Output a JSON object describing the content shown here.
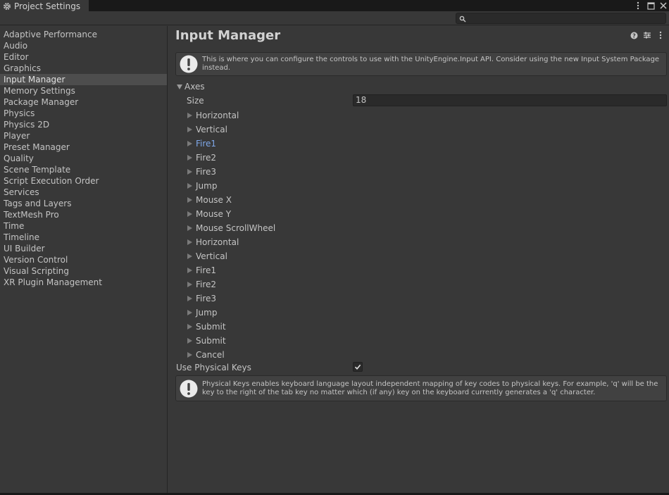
{
  "window": {
    "tab_title": "Project Settings"
  },
  "search": {
    "placeholder": "",
    "value": ""
  },
  "sidebar": {
    "items": [
      {
        "label": "Adaptive Performance",
        "selected": false
      },
      {
        "label": "Audio",
        "selected": false
      },
      {
        "label": "Editor",
        "selected": false
      },
      {
        "label": "Graphics",
        "selected": false
      },
      {
        "label": "Input Manager",
        "selected": true
      },
      {
        "label": "Memory Settings",
        "selected": false
      },
      {
        "label": "Package Manager",
        "selected": false
      },
      {
        "label": "Physics",
        "selected": false
      },
      {
        "label": "Physics 2D",
        "selected": false
      },
      {
        "label": "Player",
        "selected": false
      },
      {
        "label": "Preset Manager",
        "selected": false
      },
      {
        "label": "Quality",
        "selected": false
      },
      {
        "label": "Scene Template",
        "selected": false
      },
      {
        "label": "Script Execution Order",
        "selected": false
      },
      {
        "label": "Services",
        "selected": false
      },
      {
        "label": "Tags and Layers",
        "selected": false
      },
      {
        "label": "TextMesh Pro",
        "selected": false
      },
      {
        "label": "Time",
        "selected": false
      },
      {
        "label": "Timeline",
        "selected": false
      },
      {
        "label": "UI Builder",
        "selected": false
      },
      {
        "label": "Version Control",
        "selected": false
      },
      {
        "label": "Visual Scripting",
        "selected": false
      },
      {
        "label": "XR Plugin Management",
        "selected": false
      }
    ]
  },
  "main": {
    "title": "Input Manager",
    "help_top": "This is where you can configure the controls to use with the UnityEngine.Input API. Consider using the new Input System Package instead.",
    "axes_label": "Axes",
    "size_label": "Size",
    "size_value": "18",
    "axes": [
      {
        "label": "Horizontal",
        "active": false
      },
      {
        "label": "Vertical",
        "active": false
      },
      {
        "label": "Fire1",
        "active": true
      },
      {
        "label": "Fire2",
        "active": false
      },
      {
        "label": "Fire3",
        "active": false
      },
      {
        "label": "Jump",
        "active": false
      },
      {
        "label": "Mouse X",
        "active": false
      },
      {
        "label": "Mouse Y",
        "active": false
      },
      {
        "label": "Mouse ScrollWheel",
        "active": false
      },
      {
        "label": "Horizontal",
        "active": false
      },
      {
        "label": "Vertical",
        "active": false
      },
      {
        "label": "Fire1",
        "active": false
      },
      {
        "label": "Fire2",
        "active": false
      },
      {
        "label": "Fire3",
        "active": false
      },
      {
        "label": "Jump",
        "active": false
      },
      {
        "label": "Submit",
        "active": false
      },
      {
        "label": "Submit",
        "active": false
      },
      {
        "label": "Cancel",
        "active": false
      }
    ],
    "physical_keys_label": "Use Physical Keys",
    "physical_keys_checked": true,
    "help_bottom": "Physical Keys enables keyboard language layout independent mapping of key codes to physical keys. For example, 'q' will be the key to the right of the tab key no matter which (if any) key on the keyboard currently generates a 'q' character."
  },
  "colors": {
    "background": "#383838",
    "selected_item": "#4d4d4d",
    "active_link": "#7ea7e8"
  }
}
